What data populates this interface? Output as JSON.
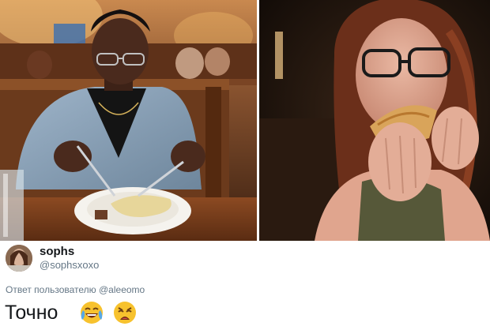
{
  "tweet": {
    "display_name": "sophs",
    "handle": "@sophsxoxo",
    "reply_to": "Ответ пользователю @aleeomo",
    "text": "Точно",
    "emojis": [
      "face-with-tears-of-joy-icon",
      "weary-face-icon"
    ]
  },
  "photos": {
    "left": "man-eating-with-knife-and-fork-photo",
    "right": "woman-eating-with-hands-photo"
  }
}
